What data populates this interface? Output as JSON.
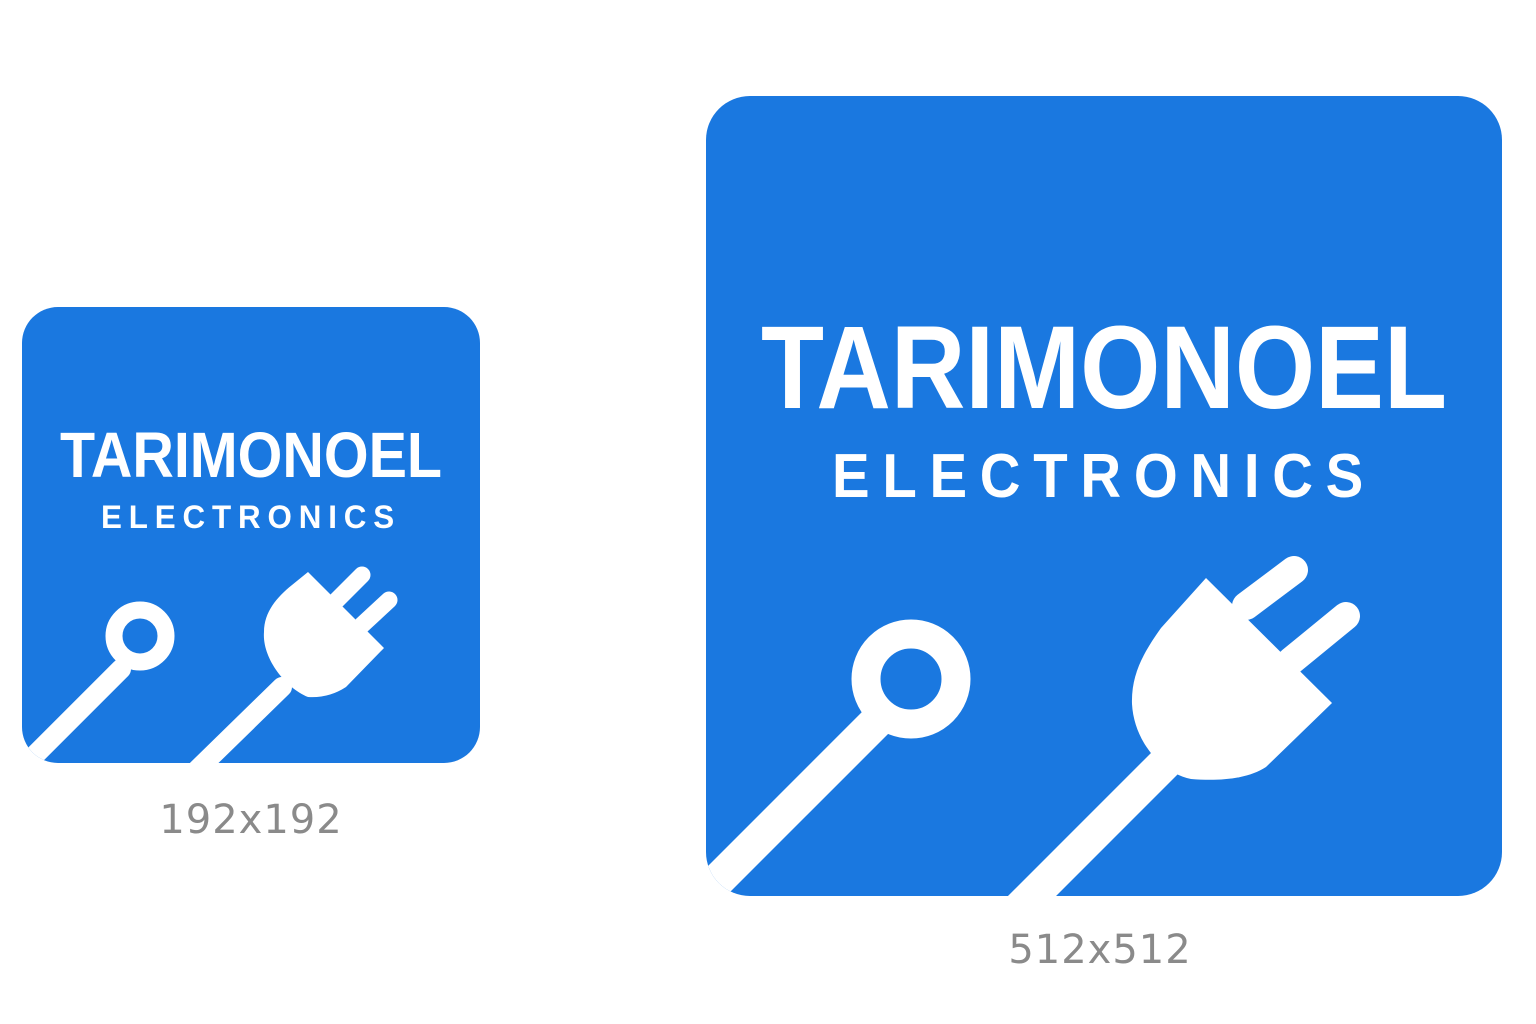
{
  "brand": {
    "name": "TARIMONOEL",
    "subtitle": "ELECTRONICS"
  },
  "icons": [
    {
      "id": "small",
      "caption": "192x192"
    },
    {
      "id": "large",
      "caption": "512x512"
    }
  ],
  "colors": {
    "background": "#ffffff",
    "icon_background": "#1a78e0",
    "foreground": "#ffffff",
    "caption": "#8a8a8a"
  },
  "graphics": {
    "left_symbol": "ring-terminal-cable-icon",
    "right_symbol": "power-plug-icon"
  }
}
